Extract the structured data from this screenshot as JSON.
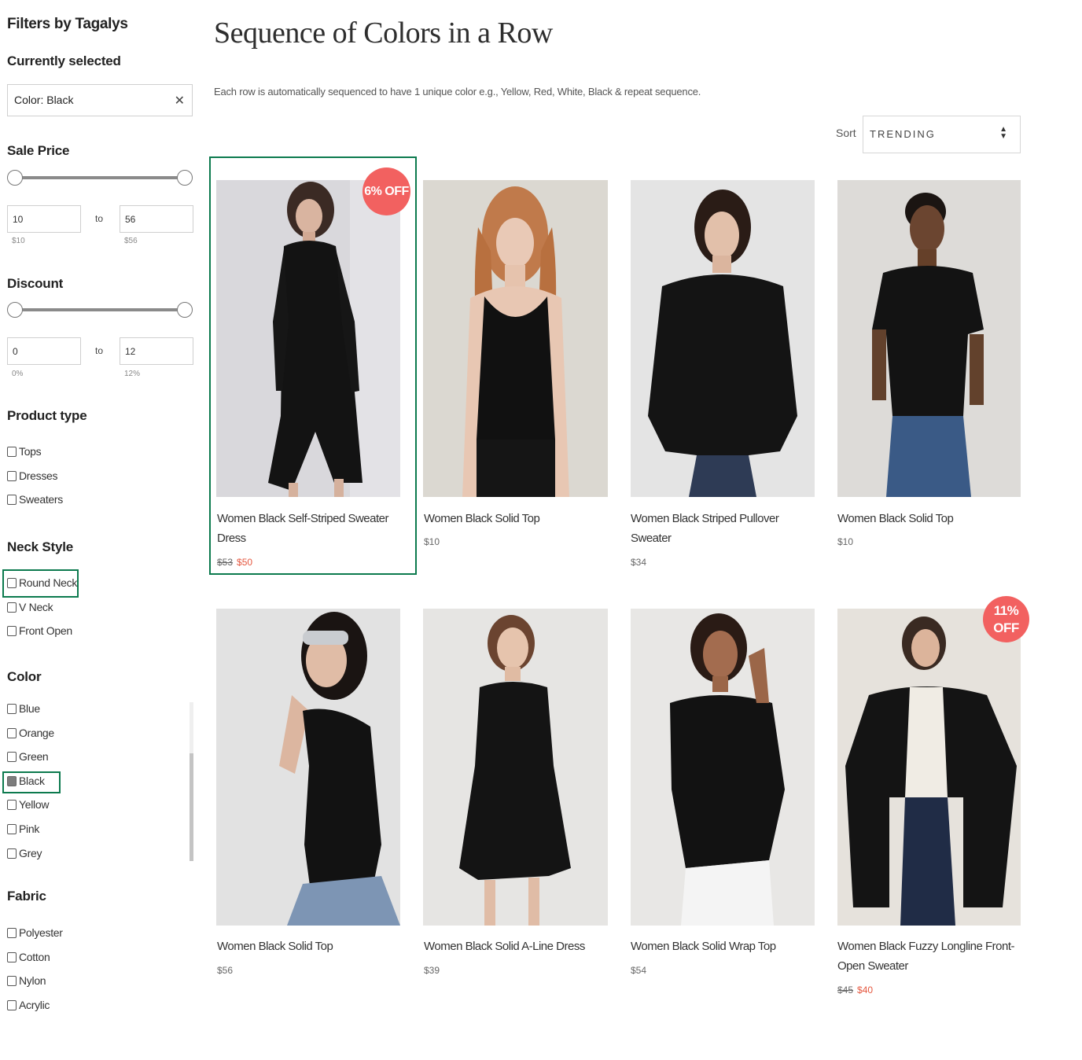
{
  "sidebar": {
    "title": "Filters by Tagalys",
    "currently_selected_heading": "Currently selected",
    "selected_chip": "Color: Black",
    "close_glyph": "✕",
    "sale_price": {
      "heading": "Sale Price",
      "from_value": "10",
      "to_value": "56",
      "to_label": "to",
      "min_label": "$10",
      "max_label": "$56"
    },
    "discount": {
      "heading": "Discount",
      "from_value": "0",
      "to_value": "12",
      "to_label": "to",
      "min_label": "0%",
      "max_label": "12%"
    },
    "product_type": {
      "heading": "Product type",
      "options": [
        "Tops",
        "Dresses",
        "Sweaters"
      ]
    },
    "neck_style": {
      "heading": "Neck Style",
      "options": [
        "Round Neck",
        "V Neck",
        "Front Open"
      ]
    },
    "color": {
      "heading": "Color",
      "options": [
        "Blue",
        "Orange",
        "Green",
        "Black",
        "Yellow",
        "Pink",
        "Grey"
      ],
      "checked": "Black"
    },
    "fabric": {
      "heading": "Fabric",
      "options": [
        "Polyester",
        "Cotton",
        "Nylon",
        "Acrylic"
      ]
    }
  },
  "main": {
    "title": "Sequence of Colors in a Row",
    "description": "Each row is automatically sequenced to have 1 unique color e.g., Yellow, Red, White, Black & repeat sequence.",
    "sort_label": "Sort",
    "sort_value": "TRENDING",
    "products": [
      {
        "name": "Women Black Self-Striped Sweater Dress",
        "price_old": "$53",
        "price_new": "$50",
        "badge": "6% OFF"
      },
      {
        "name": "Women Black Solid Top",
        "price": "$10"
      },
      {
        "name": "Women Black Striped Pullover Sweater",
        "price": "$34"
      },
      {
        "name": "Women Black Solid Top",
        "price": "$10"
      },
      {
        "name": "Women Black Solid Top",
        "price": "$56"
      },
      {
        "name": "Women Black Solid A-Line Dress",
        "price": "$39"
      },
      {
        "name": "Women Black Solid Wrap Top",
        "price": "$54"
      },
      {
        "name": "Women Black Fuzzy Longline Front-Open Sweater",
        "price_old": "$45",
        "price_new": "$40",
        "badge": "11% OFF"
      }
    ]
  },
  "colors": {
    "highlight_border": "#0c7a4e",
    "badge_bg": "#f26160",
    "sale_price_text": "#e5573f"
  }
}
